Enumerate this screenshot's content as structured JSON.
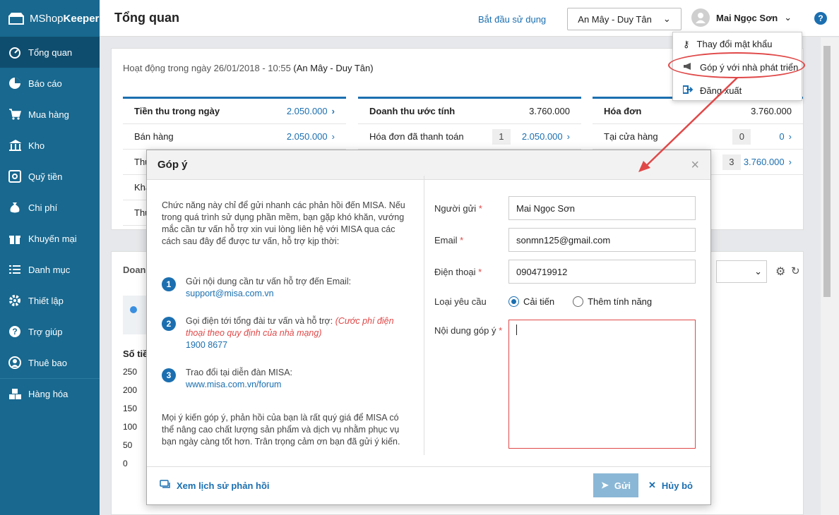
{
  "app": {
    "brand_light": "MShop",
    "brand_bold": "Keeper"
  },
  "sidebar": {
    "items": [
      {
        "label": "Tổng quan",
        "icon": "speedometer-icon"
      },
      {
        "label": "Báo cáo",
        "icon": "pie-chart-icon"
      },
      {
        "label": "Mua hàng",
        "icon": "cart-icon"
      },
      {
        "label": "Kho",
        "icon": "warehouse-icon"
      },
      {
        "label": "Quỹ tiền",
        "icon": "safe-icon"
      },
      {
        "label": "Chi phí",
        "icon": "money-bag-icon"
      },
      {
        "label": "Khuyến mại",
        "icon": "gift-icon"
      },
      {
        "label": "Danh mục",
        "icon": "list-icon"
      },
      {
        "label": "Thiết lập",
        "icon": "gear-icon"
      },
      {
        "label": "Trợ giúp",
        "icon": "question-icon"
      },
      {
        "label": "Thuê bao",
        "icon": "user-icon"
      },
      {
        "label": "Hàng hóa",
        "icon": "boxes-icon"
      }
    ]
  },
  "header": {
    "title": "Tổng quan",
    "start_link": "Bắt đầu sử dụng",
    "store": "An Mây - Duy Tân",
    "user": "Mai Ngọc Sơn"
  },
  "dropdown": {
    "items": [
      "Thay đổi mật khẩu",
      "Góp ý với nhà phát triển",
      "Đăng xuất"
    ]
  },
  "activity": {
    "prefix": "Hoạt động trong ngày 26/01/2018 - 10:55",
    "store": "(An Mây - Duy Tân)"
  },
  "cards": [
    {
      "title": "Tiền thu trong ngày",
      "title_value": "2.050.000",
      "rows": [
        {
          "label": "Bán hàng",
          "value": "2.050.000"
        },
        {
          "label": "Thu",
          "value": ""
        },
        {
          "label": "Khá",
          "value": ""
        },
        {
          "label": "Thu",
          "value": ""
        }
      ]
    },
    {
      "title": "Doanh thu ước tính",
      "title_value": "3.760.000",
      "rows": [
        {
          "label": "Hóa đơn đã thanh toán",
          "count": "1",
          "value": "2.050.000"
        }
      ]
    },
    {
      "title": "Hóa đơn",
      "title_value": "3.760.000",
      "rows": [
        {
          "label": "Tại cửa hàng",
          "count": "0",
          "value": "0"
        },
        {
          "label": "",
          "count": "3",
          "value": "3.760.000"
        }
      ]
    }
  ],
  "panel2": {
    "label": "Doanh",
    "axis": "Số tiề",
    "ticks": [
      "250",
      "200",
      "150",
      "100",
      "50",
      "0"
    ]
  },
  "modal": {
    "title": "Góp ý",
    "intro": "Chức năng này chỉ để gửi nhanh các phản hồi đến MISA. Nếu trong quá trình sử dụng phần mềm, bạn gặp khó khăn, vướng mắc cần tư vấn hỗ trợ xin vui lòng liên hệ với MISA qua các cách sau đây để được tư vấn, hỗ trợ kịp thời:",
    "steps": [
      {
        "num": "1",
        "text": "Gửi nội dung cần tư vấn hỗ trợ đến Email:",
        "note": "",
        "link": "support@misa.com.vn"
      },
      {
        "num": "2",
        "text": "Gọi điện tới tổng đài tư vấn và hỗ trợ:",
        "note": "(Cước phí điện thoại theo quy định của nhà mạng)",
        "link": "1900 8677"
      },
      {
        "num": "3",
        "text": "Trao đổi tại diễn đàn MISA:",
        "note": "",
        "link": "www.misa.com.vn/forum"
      }
    ],
    "outro": "Mọi ý kiến góp ý, phản hồi của bạn là rất quý giá để MISA có thể nâng cao chất lượng sản phẩm và dịch vụ nhằm phục vụ bạn ngày càng tốt hơn. Trân trọng cảm ơn bạn đã gửi ý kiến.",
    "form": {
      "sender_label": "Người gửi",
      "sender_value": "Mai Ngọc Sơn",
      "email_label": "Email",
      "email_value": "sonmn125@gmail.com",
      "phone_label": "Điện thoại",
      "phone_value": "0904719912",
      "type_label": "Loại yêu cầu",
      "type_opt1": "Cải tiến",
      "type_opt2": "Thêm tính năng",
      "content_label": "Nội dung góp ý"
    },
    "footer": {
      "history": "Xem lịch sử phản hồi",
      "send": "Gửi",
      "cancel": "Hủy bỏ"
    }
  },
  "colors": {
    "sidebar": "#18688f",
    "accent": "#1b6fb0",
    "highlight": "#e04848"
  }
}
